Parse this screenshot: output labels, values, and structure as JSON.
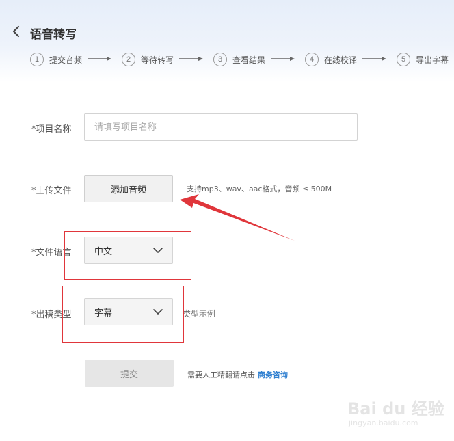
{
  "header": {
    "title": "语音转写",
    "steps": [
      {
        "num": "1",
        "label": "提交音频"
      },
      {
        "num": "2",
        "label": "等待转写"
      },
      {
        "num": "3",
        "label": "查看结果"
      },
      {
        "num": "4",
        "label": "在线校译"
      },
      {
        "num": "5",
        "label": "导出字幕"
      }
    ]
  },
  "form": {
    "project_name": {
      "label": "*项目名称",
      "placeholder": "请填写项目名称",
      "value": ""
    },
    "upload": {
      "label": "*上传文件",
      "button": "添加音频",
      "hint": "支持mp3、wav、aac格式，音频 ≤ 500M"
    },
    "language": {
      "label": "*文件语言",
      "selected": "中文"
    },
    "output_type": {
      "label": "*出稿类型",
      "selected": "字幕",
      "sample_link": "类型示例"
    },
    "submit": {
      "button": "提交",
      "note": "需要人工精翻请点击",
      "consult_link": "商务咨询"
    }
  },
  "annotation": {
    "color": "#e0363b"
  },
  "watermark": {
    "brand": "Bai du 经验",
    "domain": "jingyan.baidu.com"
  },
  "icons": [
    "chevron-left-icon",
    "arrow-right-icon",
    "chevron-down-icon"
  ]
}
